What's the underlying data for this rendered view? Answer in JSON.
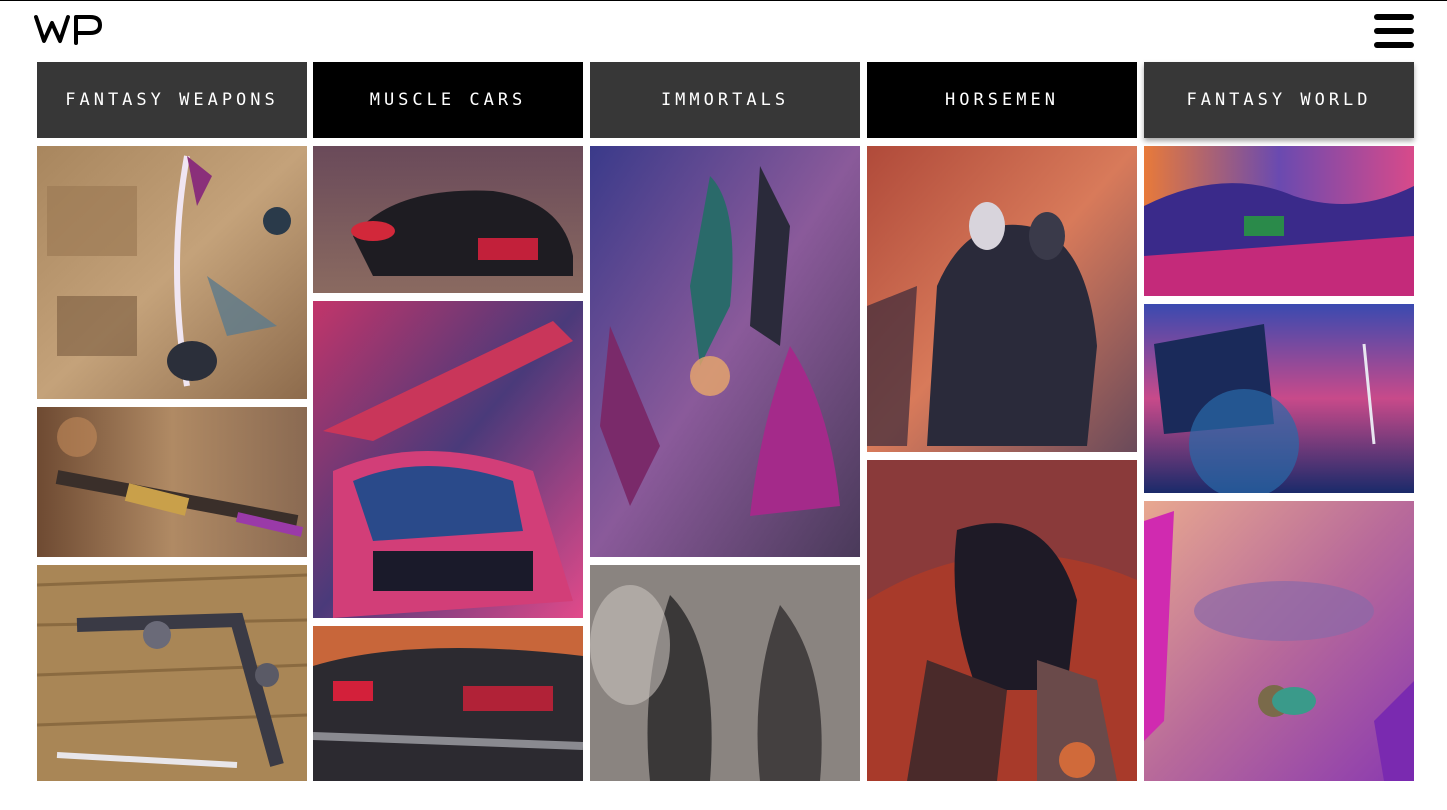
{
  "logo": {
    "text": "WP",
    "icon": "wp-logo-icon"
  },
  "menu": {
    "icon": "hamburger-menu-icon"
  },
  "categories": [
    {
      "label": "FANTASY WEAPONS"
    },
    {
      "label": "MUSCLE CARS"
    },
    {
      "label": "IMMORTALS"
    },
    {
      "label": "HORSEMEN"
    },
    {
      "label": "FANTASY WORLD"
    }
  ],
  "colors": {
    "dark_tab": "#373737",
    "black_tab": "#000000",
    "tab_text": "#ffffff"
  }
}
